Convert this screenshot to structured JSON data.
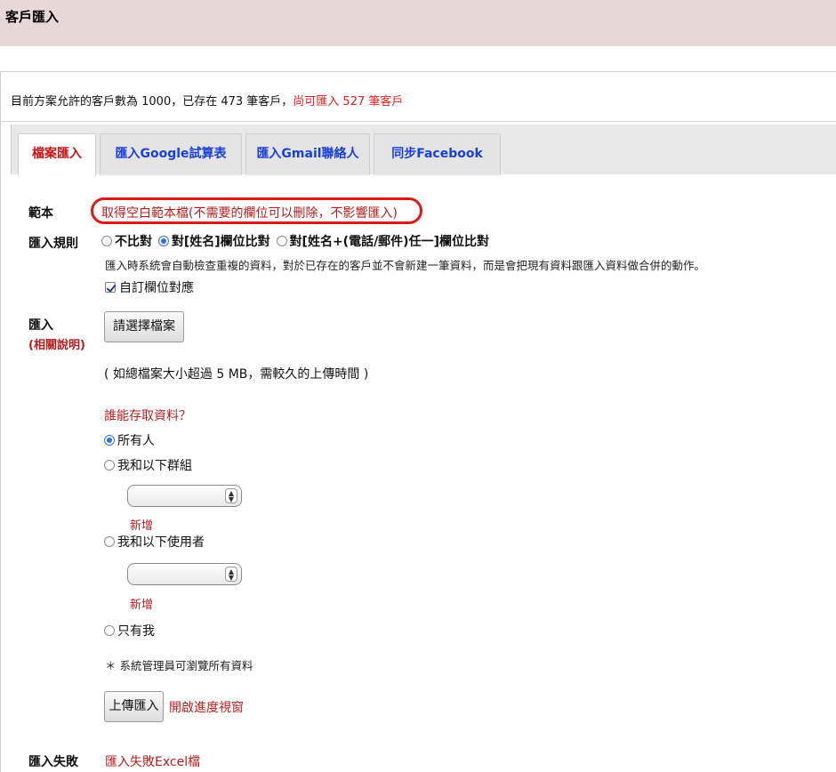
{
  "header": {
    "title": "客戶匯入"
  },
  "quota": {
    "text": "目前方案允許的客戶數為 1000，已存在 473 筆客戶，",
    "remaining": "尚可匯入 527 筆客戶"
  },
  "tabs": [
    {
      "label": "檔案匯入",
      "active": true
    },
    {
      "label": "匯入Google試算表",
      "active": false
    },
    {
      "label": "匯入Gmail聯絡人",
      "active": false
    },
    {
      "label": "同步Facebook",
      "active": false
    }
  ],
  "template": {
    "label": "範本",
    "link": "取得空白範本檔(不需要的欄位可以刪除，不影響匯入)"
  },
  "rules": {
    "label": "匯入規則",
    "options": [
      "不比對",
      "對[姓名]欄位比對",
      "對[姓名+(電話/郵件)任一]欄位比對"
    ],
    "selected_index": 1,
    "note": "匯入時系統會自動檢查重複的資料，對於已存在的客戶並不會新建一筆資料，而是會把現有資料跟匯入資料做合併的動作。",
    "custom_mapping": "自訂欄位對應",
    "custom_mapping_checked": true
  },
  "import": {
    "label": "匯入",
    "help_link": "(相關說明)",
    "choose_button": "請選擇檔案",
    "size_note": "( 如總檔案大小超過 5 MB，需較久的上傳時間 )",
    "access_question": "誰能存取資料？",
    "access_options": {
      "everyone": "所有人",
      "me_and_groups": "我和以下群組",
      "me_and_users": "我和以下使用者",
      "only_me": "只有我"
    },
    "access_selected": "everyone",
    "group_select_value": "",
    "user_select_value": "",
    "add_label": "新增",
    "admin_note": "＊ 系統管理員可瀏覽所有資料",
    "upload_button": "上傳匯入",
    "progress_link": "開啟進度視窗"
  },
  "failed": {
    "label": "匯入失敗",
    "link": "匯入失敗Excel檔"
  },
  "colors": {
    "header_bg": "#e7d7d7",
    "link_red": "#b51d1d",
    "tab_blue": "#1a3fd9",
    "highlight_red": "#e01818"
  }
}
